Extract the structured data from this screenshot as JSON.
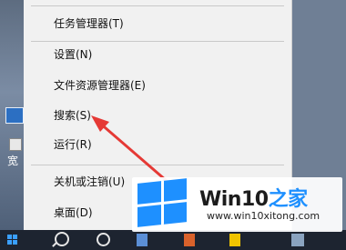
{
  "menu": {
    "items": [
      {
        "label": "任务管理器(T)"
      },
      {
        "label": "设置(N)"
      },
      {
        "label": "文件资源管理器(E)"
      },
      {
        "label": "搜索(S)"
      },
      {
        "label": "运行(R)"
      },
      {
        "label": "关机或注销(U)"
      },
      {
        "label": "桌面(D)"
      }
    ]
  },
  "desktop": {
    "icon_label": "宽"
  },
  "watermark": {
    "title_main": "Win10",
    "title_accent": "之家",
    "url": "www.win10xitong.com"
  },
  "colors": {
    "menu_bg": "#f1f1f1",
    "arrow": "#e53935",
    "taskbar": "#1d2430",
    "accent": "#1e90ff"
  }
}
